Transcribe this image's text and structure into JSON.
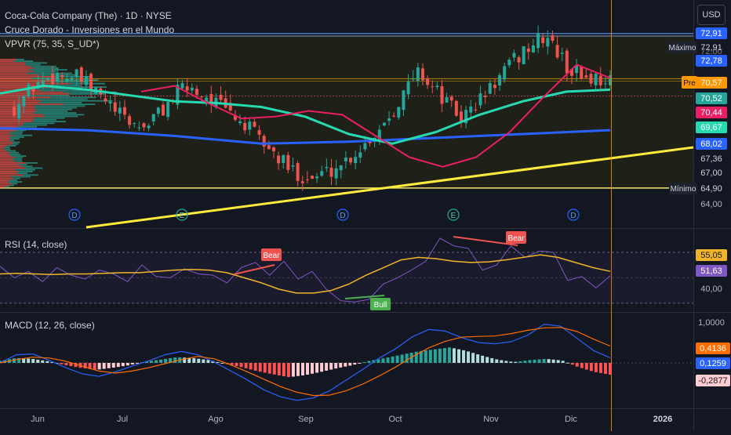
{
  "header": {
    "symbol_line": "Coca-Cola Company (The) · 1D · NYSE",
    "indicator_1": "Cruce Dorado - Inversiones en el Mundo",
    "indicator_2": "VPVR (75, 35, S_UD*)",
    "currency_button": "USD"
  },
  "colors": {
    "background": "#131722",
    "bull": "#26a69a",
    "bear": "#ef5350",
    "ma_fast": "#e91e63",
    "ma_mid": "#26d9b0",
    "ma_slow": "#2962ff",
    "trendline": "#ffeb3b",
    "rsi_line": "#7e57c2",
    "rsi_ma": "#f0b429",
    "macd_line": "#2962ff",
    "signal_line": "#ff6d00"
  },
  "chart_data": [
    {
      "type": "candlestick",
      "title": "Coca-Cola Company (The) · 1D · NYSE",
      "x_ticks": [
        "Jun",
        "Jul",
        "Ago",
        "Sep",
        "Oct",
        "Nov",
        "Dic",
        "2026"
      ],
      "y_ticks": [
        64.0,
        67.0,
        72.0
      ],
      "ylim": [
        63.5,
        73.5
      ],
      "close_path": [
        [
          "Jun",
          69.1
        ],
        [
          "Jun",
          70.3
        ],
        [
          "Jun",
          70.8
        ],
        [
          "Jul",
          70.6
        ],
        [
          "Jul",
          69.7
        ],
        [
          "Jul",
          68.6
        ],
        [
          "Ago",
          68.0
        ],
        [
          "Ago",
          69.0
        ],
        [
          "Ago",
          70.2
        ],
        [
          "Ago",
          69.7
        ],
        [
          "Sep",
          68.9
        ],
        [
          "Sep",
          68.0
        ],
        [
          "Sep",
          66.9
        ],
        [
          "Sep",
          65.8
        ],
        [
          "Sep",
          65.4
        ],
        [
          "Oct",
          65.9
        ],
        [
          "Oct",
          66.7
        ],
        [
          "Oct",
          67.8
        ],
        [
          "Oct",
          69.3
        ],
        [
          "Oct",
          71.0
        ],
        [
          "Nov",
          69.7
        ],
        [
          "Nov",
          68.5
        ],
        [
          "Nov",
          69.6
        ],
        [
          "Nov",
          70.9
        ],
        [
          "Nov",
          72.1
        ],
        [
          "Dic",
          72.8
        ],
        [
          "Dic",
          71.1
        ],
        [
          "Dic",
          70.6
        ],
        [
          "Dic",
          70.57
        ]
      ],
      "moving_averages": [
        {
          "name": "",
          "color": "#e91e63",
          "values": [
            69.9,
            70.2,
            69.3,
            68.5,
            68.6,
            68.9,
            68.7,
            67.6,
            66.5,
            66.0,
            66.5,
            67.8,
            69.6,
            71.3,
            70.6
          ]
        },
        {
          "name": "",
          "color": "#26d9b0",
          "values": [
            69.8,
            70.2,
            70.0,
            69.7,
            69.4,
            69.3,
            69.1,
            68.6,
            67.7,
            67.2,
            67.8,
            68.7,
            69.4,
            69.9,
            70.0
          ]
        },
        {
          "name": "",
          "color": "#2962ff",
          "values": [
            68.0,
            67.9,
            67.6,
            67.2,
            67.3,
            67.5,
            67.7,
            67.9
          ]
        }
      ],
      "price_labels": [
        {
          "text": "72,91",
          "color": "#2962ff"
        },
        {
          "text": "72,91",
          "color": "#131722"
        },
        {
          "text": "72,78",
          "color": "#2962ff"
        },
        {
          "text": "70,57",
          "color": "#ff9800"
        },
        {
          "text": "70,52",
          "color": "#26a69a"
        },
        {
          "text": "70,44",
          "color": "#e91e63"
        },
        {
          "text": "69,67",
          "color": "#26d9b0"
        },
        {
          "text": "68,02",
          "color": "#2962ff"
        },
        {
          "text": "67,36",
          "color": "#131722"
        },
        {
          "text": "67,00",
          "color": "#131722"
        },
        {
          "text": "64,90",
          "color": "#131722"
        }
      ],
      "side_tags": {
        "max": "Máximo",
        "pre": "Pre",
        "min": "Mínimo"
      },
      "earnings_markers": [
        "D",
        "E",
        "D",
        "E",
        "D"
      ],
      "grid": false
    },
    {
      "type": "line",
      "title": "RSI (14, close)",
      "ylim": [
        25,
        85
      ],
      "y_ticks": [
        40.0
      ],
      "series": [
        {
          "name": "",
          "color": "#7e57c2",
          "values": [
            59,
            50,
            55,
            47,
            58,
            52,
            49,
            56,
            53,
            47,
            60,
            51,
            50,
            57,
            53,
            52,
            46,
            58,
            62,
            52,
            63,
            49,
            55,
            41,
            32,
            31,
            33,
            45,
            50,
            56,
            63,
            81,
            75,
            73,
            56,
            60,
            75,
            66,
            71,
            70,
            48,
            51,
            42,
            51.63
          ]
        },
        {
          "name": "",
          "color": "#f0b429",
          "values": [
            53,
            53.5,
            53,
            52.5,
            53,
            53,
            53.5,
            54,
            54,
            55,
            56,
            56.5,
            56,
            54,
            50,
            46,
            41,
            38,
            38,
            40,
            45,
            52,
            58,
            64,
            66,
            65,
            63,
            62,
            62.5,
            64,
            66,
            68,
            66,
            62,
            58,
            55.05
          ]
        }
      ],
      "labels": [
        "51,63",
        "55,05",
        "40,00"
      ],
      "divergence_tags": [
        "Bear",
        "Bull",
        "Bear"
      ]
    },
    {
      "type": "bar",
      "title": "MACD (12, 26, close)",
      "ylim": [
        -1.25,
        1.1
      ],
      "y_ticks": [
        1.0
      ],
      "histogram": [
        0.05,
        0.12,
        0.1,
        0.04,
        -0.05,
        -0.12,
        -0.17,
        -0.12,
        -0.06,
        0.03,
        0.08,
        0.14,
        0.12,
        0.07,
        -0.02,
        -0.1,
        -0.2,
        -0.28,
        -0.35,
        -0.3,
        -0.22,
        -0.13,
        -0.05,
        0.05,
        0.12,
        0.2,
        0.28,
        0.33,
        0.38,
        0.3,
        0.18,
        0.08,
        0.02,
        0.07,
        0.1,
        0.06,
        -0.1,
        -0.22,
        -0.29
      ],
      "series": [
        {
          "name": "",
          "color": "#2962ff",
          "values": [
            0.0,
            0.2,
            0.22,
            0.06,
            -0.12,
            -0.27,
            -0.33,
            -0.22,
            -0.08,
            0.05,
            0.2,
            0.28,
            0.2,
            0.02,
            -0.2,
            -0.42,
            -0.66,
            -0.83,
            -0.92,
            -0.86,
            -0.68,
            -0.42,
            -0.16,
            0.12,
            0.35,
            0.64,
            0.82,
            0.78,
            0.62,
            0.5,
            0.47,
            0.52,
            0.68,
            0.95,
            0.9,
            0.6,
            0.3,
            0.1259
          ]
        },
        {
          "name": "",
          "color": "#ff6d00",
          "values": [
            0.0,
            0.08,
            0.14,
            0.12,
            0.04,
            -0.08,
            -0.2,
            -0.25,
            -0.2,
            -0.12,
            -0.02,
            0.08,
            0.16,
            0.1,
            -0.05,
            -0.22,
            -0.4,
            -0.58,
            -0.72,
            -0.8,
            -0.79,
            -0.68,
            -0.52,
            -0.32,
            -0.1,
            0.15,
            0.37,
            0.53,
            0.63,
            0.65,
            0.66,
            0.72,
            0.8,
            0.86,
            0.87,
            0.77,
            0.58,
            0.4136
          ]
        }
      ],
      "labels": [
        "0,4136",
        "0,1259",
        "-0,2877",
        "1,0000"
      ]
    }
  ]
}
